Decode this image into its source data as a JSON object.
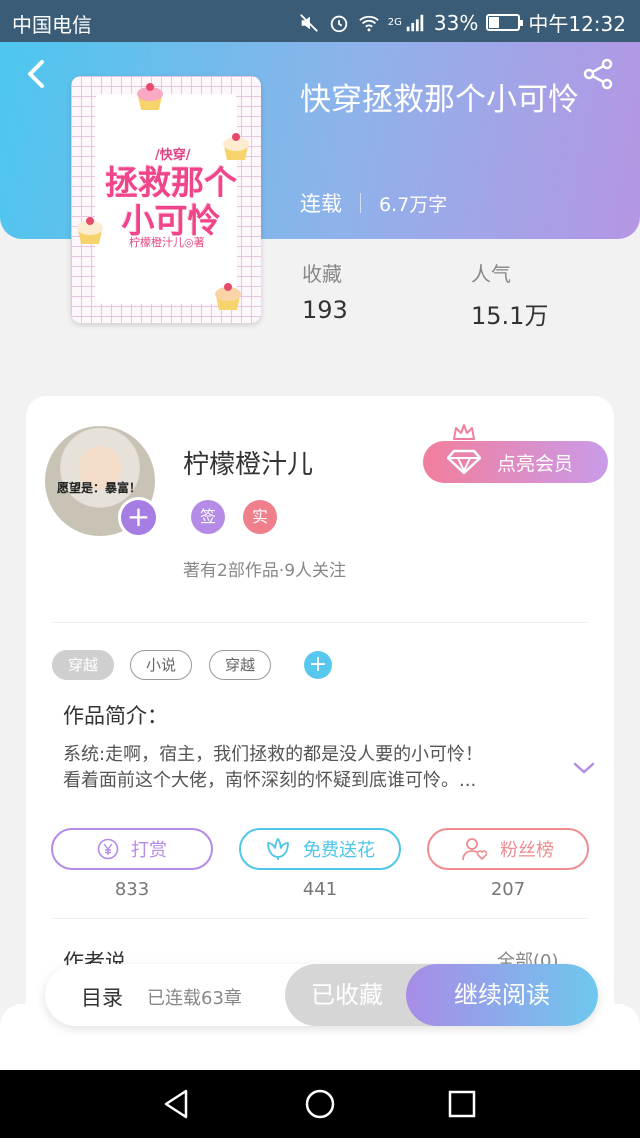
{
  "status_bar": {
    "carrier": "中国电信",
    "network": "2G",
    "battery_percent": "33%",
    "battery_level": 0.33,
    "time": "中午12:32"
  },
  "book": {
    "title": "快穿拯救那个小可怜",
    "status": "连载",
    "word_count": "6.7万字",
    "cover": {
      "tag": "/快穿/",
      "title": "拯救那个小可怜",
      "author": "柠檬橙汁儿◎著"
    },
    "stats": [
      {
        "label": "收藏",
        "value": "193"
      },
      {
        "label": "人气",
        "value": "15.1万"
      }
    ]
  },
  "author": {
    "name": "柠檬橙汁儿",
    "avatar_caption": "愿望是：暴富！",
    "badges": [
      {
        "label": "签",
        "color": "#b48be6"
      },
      {
        "label": "实",
        "color": "#f07f8c"
      }
    ],
    "stats": "著有2部作品·9人关注",
    "vip_button": "点亮会员"
  },
  "tags": [
    "穿越",
    "小说",
    "穿越"
  ],
  "synopsis": {
    "title": "作品简介：",
    "line1": "系统:走啊，宿主，我们拯救的都是没人要的小可怜！",
    "line2": "看着面前这个大佬，南怀深刻的怀疑到底谁可怜。..."
  },
  "actions": [
    {
      "label": "打赏",
      "count": "833",
      "color": "#b48be6",
      "icon": "yen-coin-icon"
    },
    {
      "label": "免费送花",
      "count": "441",
      "color": "#4ec6e8",
      "icon": "flower-icon"
    },
    {
      "label": "粉丝榜",
      "count": "207",
      "color": "#ee8d90",
      "icon": "fan-ranking-icon"
    }
  ],
  "author_says": {
    "title": "作者说",
    "see_all": "全部(0)"
  },
  "bottom_bar": {
    "toc": "目录",
    "chapters": "已连载63章",
    "collected": "已收藏",
    "continue": "继续阅读"
  },
  "colors": {
    "header_start": "#4cc7ee",
    "header_end": "#b596e4",
    "accent_purple": "#a67de2",
    "vip_pink": "#f27e9c"
  }
}
